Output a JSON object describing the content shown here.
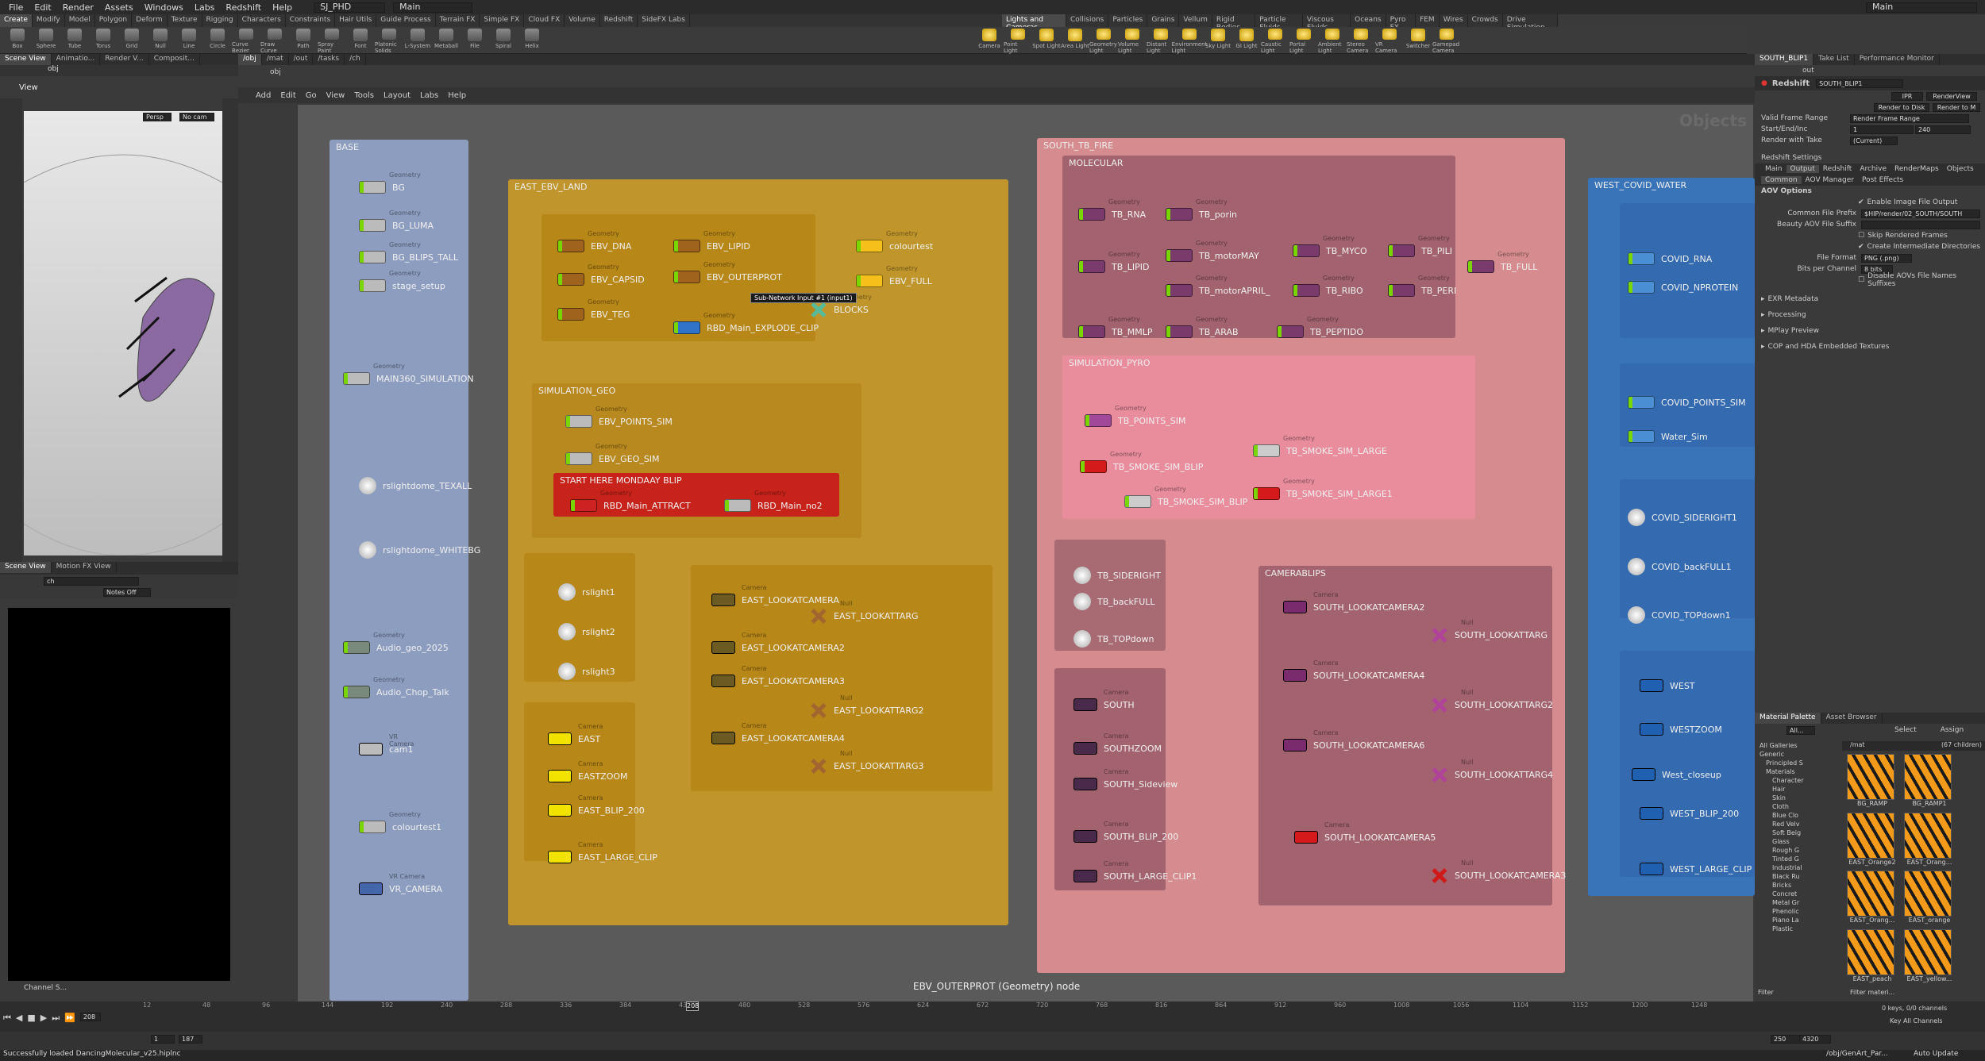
{
  "menu": [
    "File",
    "Edit",
    "Render",
    "Assets",
    "Windows",
    "Labs",
    "Redshift",
    "Help"
  ],
  "desk": "SJ_PHD",
  "take": "Main",
  "desk_right": "Main",
  "shelf_tabs": [
    "Create",
    "Modify",
    "Model",
    "Polygon",
    "Deform",
    "Texture",
    "Rigging",
    "Characters",
    "Constraints",
    "Hair Utils",
    "Guide Process",
    "Terrain FX",
    "Simple FX",
    "Cloud FX",
    "Volume",
    "Redshift",
    "SideFX Labs"
  ],
  "shelf_tabs_right": [
    "Lights and Cameras",
    "Collisions",
    "Particles",
    "Grains",
    "Vellum",
    "Rigid Bodies",
    "Particle Fluids",
    "Viscous Fluids",
    "Oceans",
    "Pyro FX",
    "FEM",
    "Wires",
    "Crowds",
    "Drive Simulation"
  ],
  "tools": [
    "Box",
    "Sphere",
    "Tube",
    "Torus",
    "Grid",
    "Null",
    "Line",
    "Circle",
    "Curve Bezier",
    "Draw Curve",
    "Path",
    "Spray Paint",
    "Font",
    "Platonic Solids",
    "L-System",
    "Metaball",
    "File",
    "Spiral",
    "Helix"
  ],
  "tools_right": [
    "Camera",
    "Point Light",
    "Spot Light",
    "Area Light",
    "Geometry Light",
    "Volume Light",
    "Distant Light",
    "Environment Light",
    "Sky Light",
    "GI Light",
    "Caustic Light",
    "Portal Light",
    "Ambient Light",
    "Stereo Camera",
    "VR Camera",
    "Switcher",
    "Gamepad Camera"
  ],
  "left_tabs": [
    "Scene View",
    "Animatio...",
    "Render V...",
    "Composit..."
  ],
  "left_path": "obj",
  "vp_menu": "View",
  "vp_persp": "Persp",
  "vp_cam": "No cam",
  "motion_tabs": [
    "Scene View",
    "Motion FX View"
  ],
  "motion_path": "ch",
  "notes": "Notes Off",
  "net_tabs": [
    "/obj",
    "/mat",
    "/out",
    "/tasks",
    "/ch"
  ],
  "net_path": "obj",
  "net_menu": [
    "Add",
    "Edit",
    "Go",
    "View",
    "Tools",
    "Layout",
    "Labs",
    "Help"
  ],
  "net_watermark": "Objects",
  "net_hint": "Sub-Network Input #1 (input1)",
  "net_status": "EBV_OUTERPROT (Geometry) node",
  "boxes": {
    "base": "BASE",
    "east": "EAST_EBV_LAND",
    "simgeo": "SIMULATION_GEO",
    "start": "START HERE MONDAAY BLIP",
    "south": "SOUTH_TB_FIRE",
    "molecular": "MOLECULAR",
    "pyro": "SIMULATION_PYRO",
    "camblips": "CAMERABLIPS",
    "west": "WEST_COVID_WATER"
  },
  "types": {
    "geo": "Geometry",
    "cam": "Camera",
    "null": "Null",
    "vr": "VR Camera"
  },
  "base_nodes": [
    "BG",
    "BG_LUMA",
    "BG_BLIPS_TALL",
    "stage_setup",
    "MAIN360_SIMULATION",
    "rslightdome_TEXALL",
    "rslightdome_WHITEBG",
    "Audio_geo_2025",
    "Audio_Chop_Talk",
    "cam1",
    "colourtest1",
    "VR_CAMERA"
  ],
  "east_nodes": [
    "EBV_DNA",
    "EBV_CAPSID",
    "EBV_TEG",
    "EBV_LIPID",
    "EBV_OUTERPROT",
    "RBD_Main_EXPLODE_CLIP",
    "colourtest",
    "EBV_FULL",
    "BLOCKS",
    "EBV_POINTS_SIM",
    "EBV_GEO_SIM",
    "RBD_Main_ATTRACT",
    "RBD_Main_no2",
    "rslight1",
    "rslight2",
    "rslight3",
    "EAST",
    "EASTZOOM",
    "EAST_BLIP_200",
    "EAST_LARGE_CLIP",
    "EAST_LOOKATCAMERA",
    "EAST_LOOKATCAMERA2",
    "EAST_LOOKATCAMERA3",
    "EAST_LOOKATCAMERA4",
    "EAST_LOOKATTARG",
    "EAST_LOOKATTARG2",
    "EAST_LOOKATTARG3"
  ],
  "south_nodes": [
    "TB_RNA",
    "TB_porin",
    "TB_LIPID",
    "TB_motorMAY",
    "TB_MYCO",
    "TB_PILI",
    "TB_FULL",
    "TB_motorAPRIL_",
    "TB_RIBO",
    "TB_PERI",
    "TB_MMLP",
    "TB_ARAB",
    "TB_PEPTIDO",
    "TB_POINTS_SIM",
    "TB_SMOKE_SIM_BLIP",
    "TB_SMOKE_SIM_LARGE",
    "TB_SMOKE_SIM_LARGE1",
    "TB_SMOKE_SIM_BLIP",
    "TB_SIDERIGHT",
    "TB_backFULL",
    "TB_TOPdown",
    "SOUTH",
    "SOUTHZOOM",
    "SOUTH_Sideview",
    "SOUTH_BLIP_200",
    "SOUTH_LARGE_CLIP1",
    "SOUTH_LOOKATCAMERA2",
    "SOUTH_LOOKATTARG",
    "SOUTH_LOOKATCAMERA4",
    "SOUTH_LOOKATTARG2",
    "SOUTH_LOOKATCAMERA6",
    "SOUTH_LOOKATTARG4",
    "SOUTH_LOOKATCAMERA5",
    "SOUTH_LOOKATCAMERA3"
  ],
  "west_nodes": [
    "COVID_RNA",
    "COVID_NPROTEIN",
    "COVID_POINTS_SIM",
    "Water_Sim",
    "COVID_SIDERIGHT1",
    "COVID_backFULL1",
    "COVID_TOPdown1",
    "WEST",
    "WESTZOOM",
    "West_closeup",
    "WEST_BLIP_200",
    "WEST_LARGE_CLIP"
  ],
  "right_tabs": [
    "SOUTH_BLIP1",
    "Take List",
    "Performance Monitor"
  ],
  "rs": {
    "path": "out",
    "title": "Redshift",
    "node": "SOUTH_BLIP1",
    "ipr": "IPR",
    "renderview": "RenderView",
    "render_disk": "Render to Disk",
    "render_m": "Render to M",
    "vfr_label": "Valid Frame Range",
    "vfr": "Render Frame Range",
    "sei_label": "Start/End/Inc",
    "start": "1",
    "end": "240",
    "take_label": "Render with Take",
    "take": "(Current)",
    "settings": "Redshift Settings",
    "tabs": [
      "Main",
      "Output",
      "Redshift",
      "Archive",
      "RenderMaps",
      "Objects"
    ],
    "subtabs": [
      "Common",
      "AOV Manager",
      "Post Effects"
    ],
    "aov": "AOV Options",
    "enable": "Enable Image File Output",
    "prefix_label": "Common File Prefix",
    "prefix": "$HIP/render/02_SOUTH/SOUTH",
    "beauty": "Beauty AOV File Suffix",
    "skip": "Skip Rendered Frames",
    "inter": "Create Intermediate Directories",
    "fmt_label": "File Format",
    "fmt": "PNG (.png)",
    "bits_label": "Bits per Channel",
    "bits": "8 bits",
    "disable": "Disable AOVs File Names Suffixes",
    "sections": [
      "EXR Metadata",
      "Processing",
      "MPlay Preview",
      "COP and HDA Embedded Textures"
    ]
  },
  "mat": {
    "tabs": [
      "Material Palette",
      "Asset Browser"
    ],
    "all": "All...",
    "select": "Select",
    "assign": "Assign",
    "path": "/mat",
    "count": "(67 children)",
    "tree": [
      "All Galleries",
      "Generic",
      "Principled S",
      "Materials",
      "Character",
      "Hair",
      "Skin",
      "Cloth",
      "Blue Clo",
      "Red Velv",
      "Soft Beig",
      "Glass",
      "Rough G",
      "Tinted G",
      "Industrial",
      "Black Ru",
      "Bricks",
      "Concret",
      "Metal Gr",
      "Phenolic",
      "Piano La",
      "Plastic"
    ],
    "thumbs": [
      "BG_RAMP",
      "BG_RAMP1",
      "EAST_Orange2",
      "EAST_Orang...",
      "EAST_Orang...",
      "EAST_orange",
      "EAST_peach",
      "EAST_yellow..."
    ],
    "filter": "Filter",
    "filter2": "Filter materi..."
  },
  "timeline": {
    "frame": "208",
    "start": "1",
    "start2": "187",
    "end": "250",
    "end2": "4320",
    "keys": "0 keys, 0/0 channels",
    "keyall": "Key All Channels",
    "ticks": [
      "12",
      "48",
      "96",
      "144",
      "192",
      "240",
      "288",
      "336",
      "384",
      "432",
      "480",
      "528",
      "576",
      "624",
      "672",
      "720",
      "768",
      "816",
      "864",
      "912",
      "960",
      "1008",
      "1056",
      "1104",
      "1152",
      "1200",
      "1248"
    ]
  },
  "channel": "Channel S...",
  "status": "Successfully loaded DancingMolecular_v25.hiplnc",
  "status_r": "/obj/GenArt_Par...",
  "autoupdate": "Auto Update",
  "colors": {
    "base": "#8d9dc0",
    "east": "#c0962c",
    "simgeo": "#b8891f",
    "start": "#c8231b",
    "south": "#d68c8e",
    "molecular": "#a3636e",
    "pyro": "#e98d9d",
    "camblips": "#a3636e",
    "west": "#3a74b8"
  }
}
